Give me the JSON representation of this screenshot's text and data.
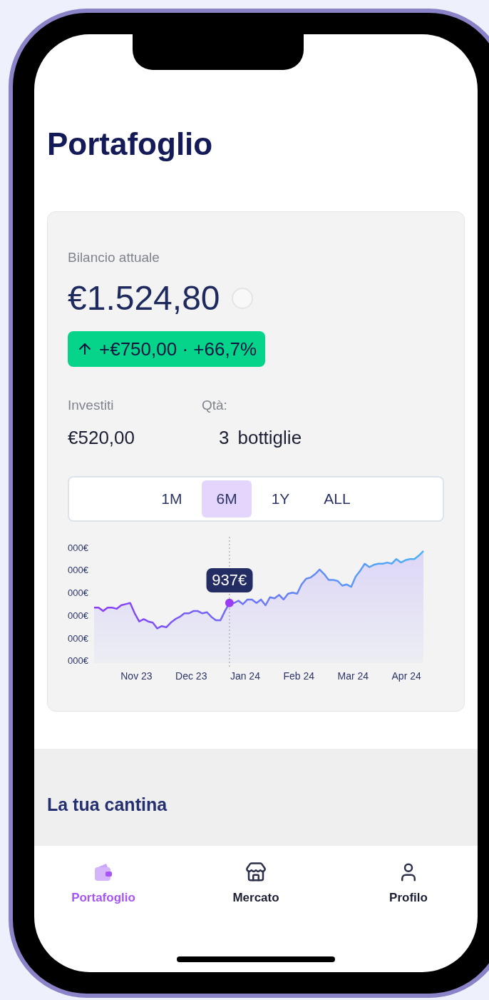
{
  "screen_title": "Portafoglio",
  "balance": {
    "label": "Bilancio attuale",
    "value": "€1.524,80",
    "change": "+€750,00 · +66,7%"
  },
  "stats": [
    {
      "label": "Investiti",
      "value": "€520,00"
    },
    {
      "label": "Qtà:",
      "value": "3",
      "unit": "bottiglie"
    }
  ],
  "periods": [
    {
      "label": "1M",
      "selected": false
    },
    {
      "label": "6M",
      "selected": true
    },
    {
      "label": "1Y",
      "selected": false
    },
    {
      "label": "ALL",
      "selected": false
    }
  ],
  "chart": {
    "y_ticks": [
      "000€",
      "000€",
      "000€",
      "000€",
      "000€",
      "000€"
    ],
    "x_labels": [
      "Nov 23",
      "Dec 23",
      "Jan 24",
      "Feb 24",
      "Mar 24",
      "Apr 24"
    ],
    "tooltip": "937€"
  },
  "cellar": {
    "title": "La tua cantina"
  },
  "nav": [
    {
      "kind": "wallet",
      "label": "Portafoglio",
      "selected": true
    },
    {
      "kind": "store",
      "label": "Mercato",
      "selected": false
    },
    {
      "kind": "user",
      "label": "Profilo",
      "selected": false
    }
  ]
}
